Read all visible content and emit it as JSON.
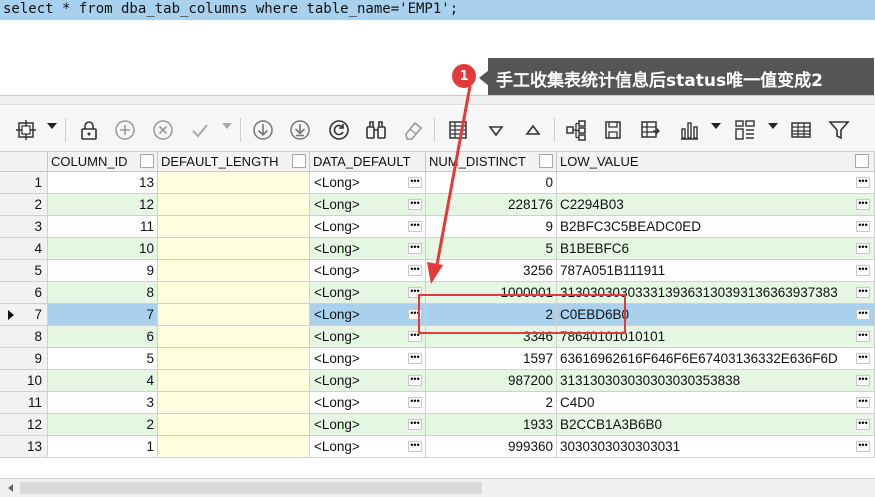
{
  "editor": {
    "sql": "select * from dba_tab_columns where table_name='EMP1';"
  },
  "annotation": {
    "number": "1",
    "text": "手工收集表统计信息后status唯一值变成2"
  },
  "toolbar": {
    "icons": [
      "grid-options-icon",
      "lock-icon",
      "add-row-icon",
      "delete-row-icon",
      "post-icon",
      "cancel-icon",
      "next-page-icon",
      "last-page-icon",
      "refresh-icon",
      "find-icon",
      "clear-icon",
      "single-record-icon",
      "sort-desc-icon",
      "sort-asc-icon",
      "tree-icon",
      "export-icon",
      "export-query-icon",
      "chart-icon",
      "pivot-icon",
      "table-view-icon",
      "filter-icon"
    ]
  },
  "grid": {
    "headers": [
      "COLUMN_ID",
      "DEFAULT_LENGTH",
      "DATA_DEFAULT",
      "NUM_DISTINCT",
      "LOW_VALUE"
    ],
    "rows": [
      {
        "rn": "1",
        "id": "13",
        "dd": "<Long>",
        "nd": "0",
        "lv": ""
      },
      {
        "rn": "2",
        "id": "12",
        "dd": "<Long>",
        "nd": "228176",
        "lv": "C2294B03"
      },
      {
        "rn": "3",
        "id": "11",
        "dd": "<Long>",
        "nd": "9",
        "lv": "B2BFC3C5BEADC0ED"
      },
      {
        "rn": "4",
        "id": "10",
        "dd": "<Long>",
        "nd": "5",
        "lv": "B1BEBFC6"
      },
      {
        "rn": "5",
        "id": "9",
        "dd": "<Long>",
        "nd": "3256",
        "lv": "787A051B111911"
      },
      {
        "rn": "6",
        "id": "8",
        "dd": "<Long>",
        "nd": "1000001",
        "lv": "3130303030333139363130393136363937383"
      },
      {
        "rn": "7",
        "id": "7",
        "dd": "<Long>",
        "nd": "2",
        "lv": "C0EBD6B0"
      },
      {
        "rn": "8",
        "id": "6",
        "dd": "<Long>",
        "nd": "3346",
        "lv": "78640101010101"
      },
      {
        "rn": "9",
        "id": "5",
        "dd": "<Long>",
        "nd": "1597",
        "lv": "63616962616F646F6E67403136332E636F6D"
      },
      {
        "rn": "10",
        "id": "4",
        "dd": "<Long>",
        "nd": "987200",
        "lv": "313130303030303030353838"
      },
      {
        "rn": "11",
        "id": "3",
        "dd": "<Long>",
        "nd": "2",
        "lv": "C4D0"
      },
      {
        "rn": "12",
        "id": "2",
        "dd": "<Long>",
        "nd": "1933",
        "lv": "B2CCB1A3B6B0"
      },
      {
        "rn": "13",
        "id": "1",
        "dd": "<Long>",
        "nd": "999360",
        "lv": "3030303030303031"
      }
    ],
    "selected_row": "7"
  },
  "colors": {
    "selection": "#a9d1ee",
    "alt_row": "#e5f7e3",
    "highlight": "#e53935",
    "callout_bg": "#555555"
  }
}
